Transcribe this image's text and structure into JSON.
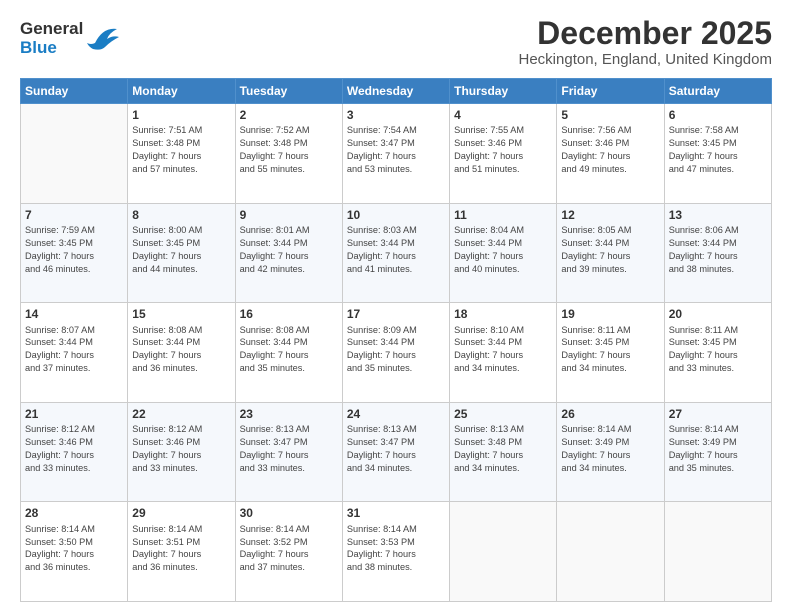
{
  "logo": {
    "line1": "General",
    "line2": "Blue"
  },
  "title": "December 2025",
  "subtitle": "Heckington, England, United Kingdom",
  "headers": [
    "Sunday",
    "Monday",
    "Tuesday",
    "Wednesday",
    "Thursday",
    "Friday",
    "Saturday"
  ],
  "weeks": [
    [
      {
        "day": "",
        "info": ""
      },
      {
        "day": "1",
        "info": "Sunrise: 7:51 AM\nSunset: 3:48 PM\nDaylight: 7 hours\nand 57 minutes."
      },
      {
        "day": "2",
        "info": "Sunrise: 7:52 AM\nSunset: 3:48 PM\nDaylight: 7 hours\nand 55 minutes."
      },
      {
        "day": "3",
        "info": "Sunrise: 7:54 AM\nSunset: 3:47 PM\nDaylight: 7 hours\nand 53 minutes."
      },
      {
        "day": "4",
        "info": "Sunrise: 7:55 AM\nSunset: 3:46 PM\nDaylight: 7 hours\nand 51 minutes."
      },
      {
        "day": "5",
        "info": "Sunrise: 7:56 AM\nSunset: 3:46 PM\nDaylight: 7 hours\nand 49 minutes."
      },
      {
        "day": "6",
        "info": "Sunrise: 7:58 AM\nSunset: 3:45 PM\nDaylight: 7 hours\nand 47 minutes."
      }
    ],
    [
      {
        "day": "7",
        "info": "Sunrise: 7:59 AM\nSunset: 3:45 PM\nDaylight: 7 hours\nand 46 minutes."
      },
      {
        "day": "8",
        "info": "Sunrise: 8:00 AM\nSunset: 3:45 PM\nDaylight: 7 hours\nand 44 minutes."
      },
      {
        "day": "9",
        "info": "Sunrise: 8:01 AM\nSunset: 3:44 PM\nDaylight: 7 hours\nand 42 minutes."
      },
      {
        "day": "10",
        "info": "Sunrise: 8:03 AM\nSunset: 3:44 PM\nDaylight: 7 hours\nand 41 minutes."
      },
      {
        "day": "11",
        "info": "Sunrise: 8:04 AM\nSunset: 3:44 PM\nDaylight: 7 hours\nand 40 minutes."
      },
      {
        "day": "12",
        "info": "Sunrise: 8:05 AM\nSunset: 3:44 PM\nDaylight: 7 hours\nand 39 minutes."
      },
      {
        "day": "13",
        "info": "Sunrise: 8:06 AM\nSunset: 3:44 PM\nDaylight: 7 hours\nand 38 minutes."
      }
    ],
    [
      {
        "day": "14",
        "info": "Sunrise: 8:07 AM\nSunset: 3:44 PM\nDaylight: 7 hours\nand 37 minutes."
      },
      {
        "day": "15",
        "info": "Sunrise: 8:08 AM\nSunset: 3:44 PM\nDaylight: 7 hours\nand 36 minutes."
      },
      {
        "day": "16",
        "info": "Sunrise: 8:08 AM\nSunset: 3:44 PM\nDaylight: 7 hours\nand 35 minutes."
      },
      {
        "day": "17",
        "info": "Sunrise: 8:09 AM\nSunset: 3:44 PM\nDaylight: 7 hours\nand 35 minutes."
      },
      {
        "day": "18",
        "info": "Sunrise: 8:10 AM\nSunset: 3:44 PM\nDaylight: 7 hours\nand 34 minutes."
      },
      {
        "day": "19",
        "info": "Sunrise: 8:11 AM\nSunset: 3:45 PM\nDaylight: 7 hours\nand 34 minutes."
      },
      {
        "day": "20",
        "info": "Sunrise: 8:11 AM\nSunset: 3:45 PM\nDaylight: 7 hours\nand 33 minutes."
      }
    ],
    [
      {
        "day": "21",
        "info": "Sunrise: 8:12 AM\nSunset: 3:46 PM\nDaylight: 7 hours\nand 33 minutes."
      },
      {
        "day": "22",
        "info": "Sunrise: 8:12 AM\nSunset: 3:46 PM\nDaylight: 7 hours\nand 33 minutes."
      },
      {
        "day": "23",
        "info": "Sunrise: 8:13 AM\nSunset: 3:47 PM\nDaylight: 7 hours\nand 33 minutes."
      },
      {
        "day": "24",
        "info": "Sunrise: 8:13 AM\nSunset: 3:47 PM\nDaylight: 7 hours\nand 34 minutes."
      },
      {
        "day": "25",
        "info": "Sunrise: 8:13 AM\nSunset: 3:48 PM\nDaylight: 7 hours\nand 34 minutes."
      },
      {
        "day": "26",
        "info": "Sunrise: 8:14 AM\nSunset: 3:49 PM\nDaylight: 7 hours\nand 34 minutes."
      },
      {
        "day": "27",
        "info": "Sunrise: 8:14 AM\nSunset: 3:49 PM\nDaylight: 7 hours\nand 35 minutes."
      }
    ],
    [
      {
        "day": "28",
        "info": "Sunrise: 8:14 AM\nSunset: 3:50 PM\nDaylight: 7 hours\nand 36 minutes."
      },
      {
        "day": "29",
        "info": "Sunrise: 8:14 AM\nSunset: 3:51 PM\nDaylight: 7 hours\nand 36 minutes."
      },
      {
        "day": "30",
        "info": "Sunrise: 8:14 AM\nSunset: 3:52 PM\nDaylight: 7 hours\nand 37 minutes."
      },
      {
        "day": "31",
        "info": "Sunrise: 8:14 AM\nSunset: 3:53 PM\nDaylight: 7 hours\nand 38 minutes."
      },
      {
        "day": "",
        "info": ""
      },
      {
        "day": "",
        "info": ""
      },
      {
        "day": "",
        "info": ""
      }
    ]
  ]
}
